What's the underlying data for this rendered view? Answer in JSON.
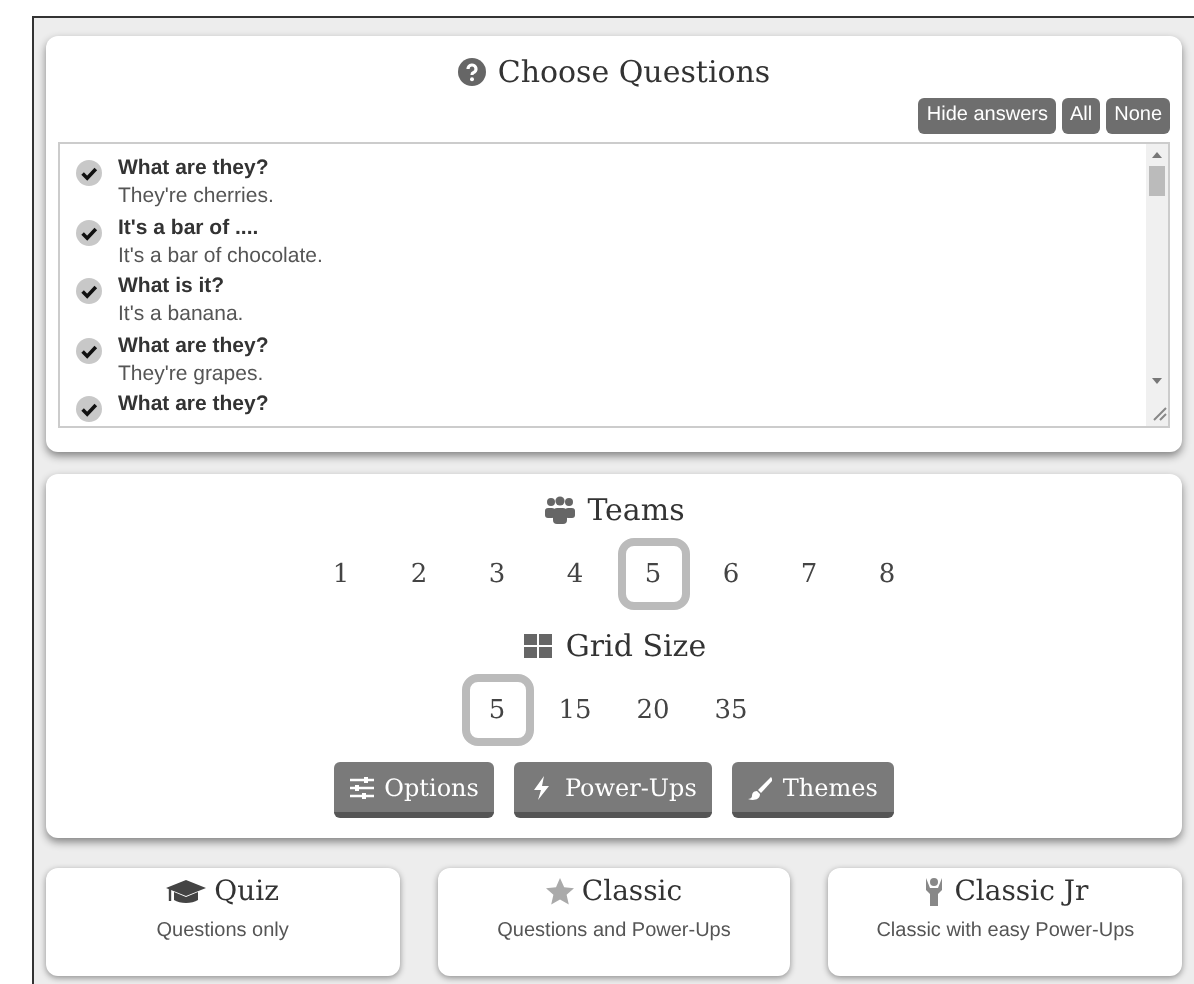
{
  "questions_panel": {
    "title": "Choose Questions",
    "buttons": [
      "Hide answers",
      "All",
      "None"
    ],
    "questions": [
      {
        "question": "What are they?",
        "answer": "They're cherries.",
        "checked": true
      },
      {
        "question": "It's a bar of ....",
        "answer": "It's a bar of chocolate.",
        "checked": true
      },
      {
        "question": "What is it?",
        "answer": "It's a banana.",
        "checked": true
      },
      {
        "question": "What are they?",
        "answer": "They're grapes.",
        "checked": true
      },
      {
        "question": "What are they?",
        "checked": true
      }
    ]
  },
  "teams": {
    "title": "Teams",
    "options": [
      {
        "label": "1",
        "selected": false
      },
      {
        "label": "2",
        "selected": false
      },
      {
        "label": "3",
        "selected": false
      },
      {
        "label": "4",
        "selected": false
      },
      {
        "label": "5",
        "selected": true
      },
      {
        "label": "6",
        "selected": false
      },
      {
        "label": "7",
        "selected": false
      },
      {
        "label": "8",
        "selected": false
      }
    ]
  },
  "grid_size": {
    "title": "Grid Size",
    "options": [
      {
        "label": "5",
        "selected": true
      },
      {
        "label": "15",
        "selected": false
      },
      {
        "label": "20",
        "selected": false
      },
      {
        "label": "35",
        "selected": false
      }
    ]
  },
  "settings_buttons": [
    {
      "kind": "options",
      "label": "Options"
    },
    {
      "kind": "powerups",
      "label": "Power-Ups"
    },
    {
      "kind": "themes",
      "label": "Themes"
    }
  ],
  "modes": [
    {
      "kind": "quiz",
      "title": "Quiz",
      "description": "Questions only"
    },
    {
      "kind": "classic",
      "title": "Classic",
      "description": "Questions and Power-Ups"
    },
    {
      "kind": "classic_jr",
      "title": "Classic Jr",
      "description": "Classic with easy Power-Ups"
    }
  ]
}
